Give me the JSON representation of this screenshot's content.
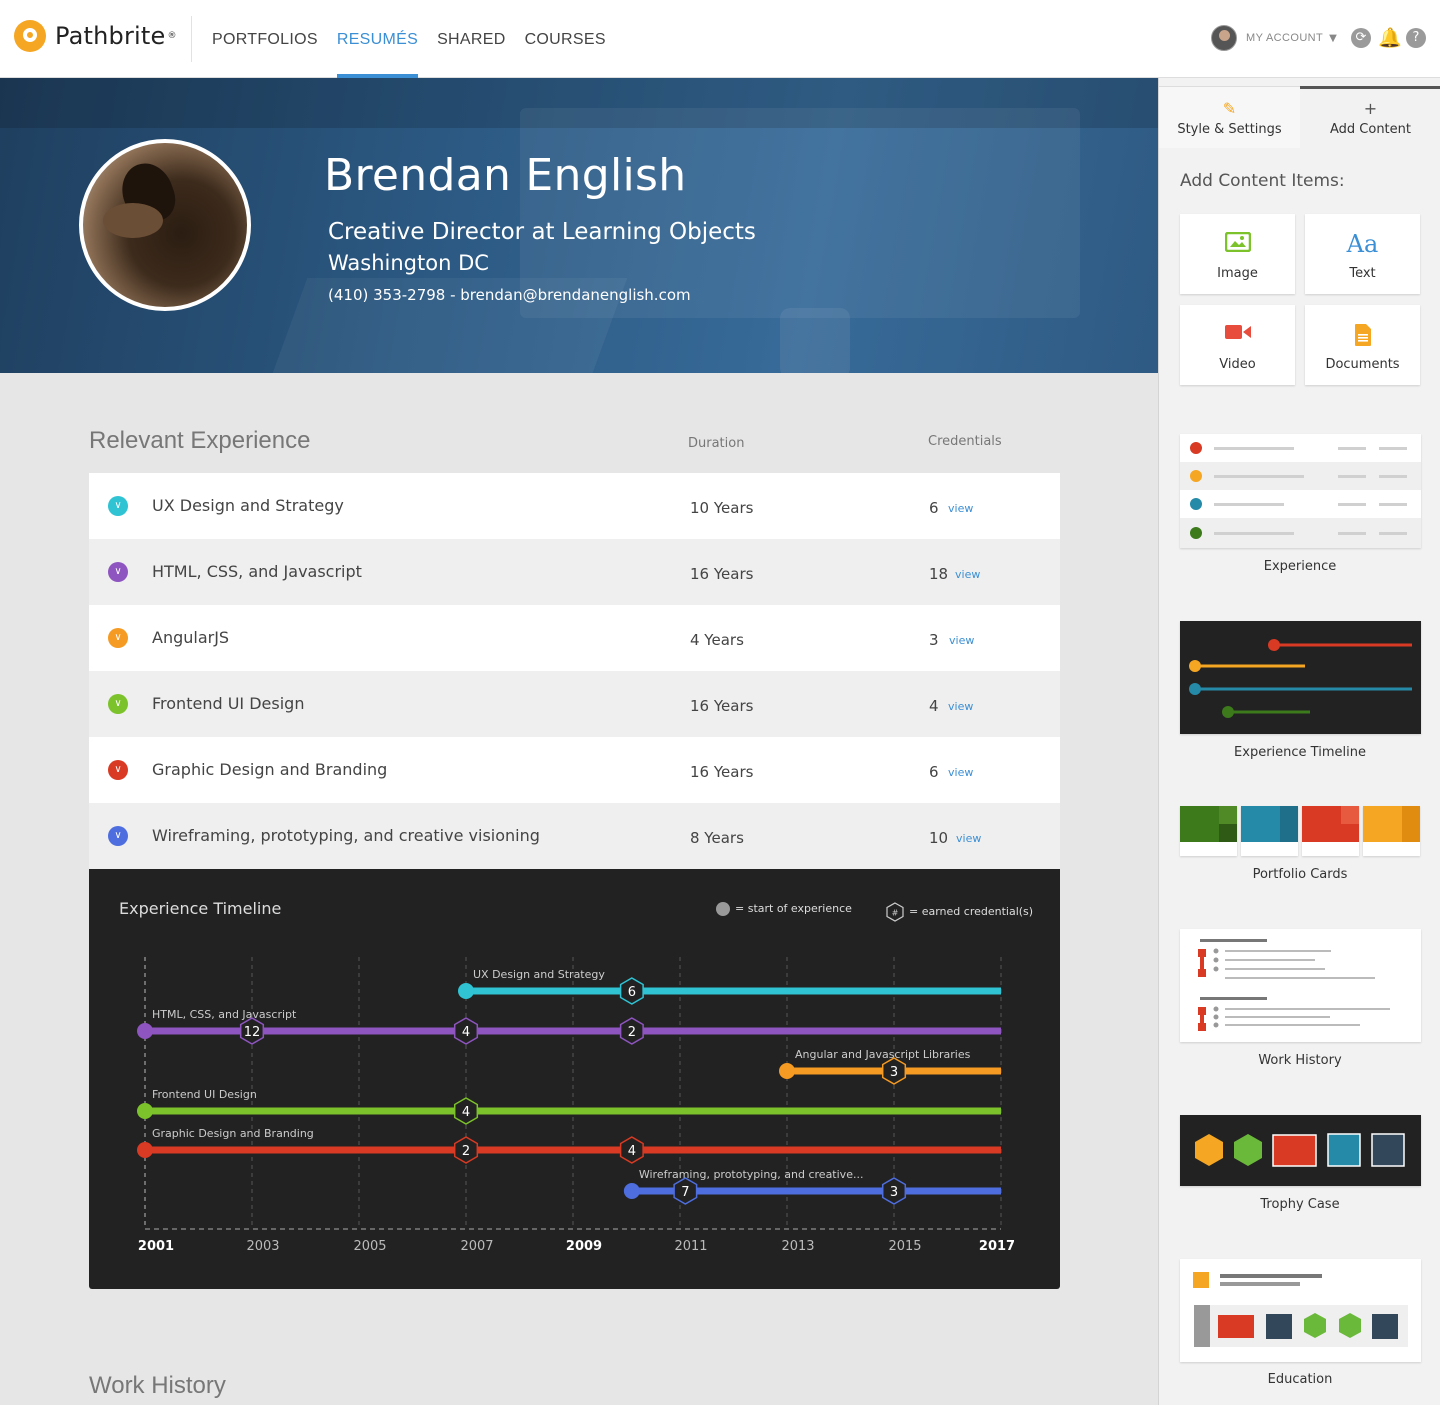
{
  "app": {
    "brand": "Pathbrite",
    "nav": [
      {
        "label": "PORTFOLIOS",
        "active": false
      },
      {
        "label": "RESUMÉS",
        "active": true
      },
      {
        "label": "SHARED",
        "active": false
      },
      {
        "label": "COURSES",
        "active": false
      }
    ],
    "account_label": "MY ACCOUNT",
    "icons": [
      "sync-icon",
      "bell-icon",
      "help-icon"
    ],
    "accent": "#3b8fd4"
  },
  "profile": {
    "name": "Brendan English",
    "title": "Creative Director at Learning Objects",
    "location": "Washington DC",
    "contact": "(410) 353-2798  -  brendan@brendanenglish.com"
  },
  "experience": {
    "section_title": "Relevant Experience",
    "col_duration": "Duration",
    "col_credentials": "Credentials",
    "view_label": "view",
    "rows": [
      {
        "name": "UX Design and Strategy",
        "duration": "10 Years",
        "credentials": "6",
        "color": "#2fc3d3"
      },
      {
        "name": "HTML, CSS, and Javascript",
        "duration": "16 Years",
        "credentials": "18",
        "color": "#8e55c0"
      },
      {
        "name": "AngularJS",
        "duration": "4 Years",
        "credentials": "3",
        "color": "#f59a22"
      },
      {
        "name": "Frontend UI Design",
        "duration": "16 Years",
        "credentials": "4",
        "color": "#7cc22a"
      },
      {
        "name": "Graphic Design and Branding",
        "duration": "16 Years",
        "credentials": "6",
        "color": "#d93a23"
      },
      {
        "name": "Wireframing, prototyping, and creative visioning",
        "duration": "8 Years",
        "credentials": "10",
        "color": "#4e6ee0"
      }
    ]
  },
  "timeline": {
    "title": "Experience Timeline",
    "legend_start": "= start of experience",
    "legend_cred": "= earned credential(s)",
    "legend_hex": "#",
    "years": [
      {
        "label": "2001",
        "year": 2001,
        "bold": true
      },
      {
        "label": "2003",
        "year": 2003,
        "bold": false
      },
      {
        "label": "2005",
        "year": 2005,
        "bold": false
      },
      {
        "label": "2007",
        "year": 2007,
        "bold": false
      },
      {
        "label": "2009",
        "year": 2009,
        "bold": true
      },
      {
        "label": "2011",
        "year": 2011,
        "bold": false
      },
      {
        "label": "2013",
        "year": 2013,
        "bold": false
      },
      {
        "label": "2015",
        "year": 2015,
        "bold": false
      },
      {
        "label": "2017",
        "year": 2017,
        "bold": true
      }
    ],
    "tracks": [
      {
        "label": "UX Design and Strategy",
        "color": "#2fc3d3",
        "start": 2007.0,
        "creds": [
          {
            "year": 2010.1,
            "n": "6"
          }
        ]
      },
      {
        "label": "HTML, CSS, and Javascript",
        "color": "#8e55c0",
        "start": 2001.0,
        "creds": [
          {
            "year": 2003.0,
            "n": "12"
          },
          {
            "year": 2007.0,
            "n": "4"
          },
          {
            "year": 2010.1,
            "n": "2"
          }
        ]
      },
      {
        "label": "Angular and Javascript Libraries",
        "color": "#f59a22",
        "start": 2013.0,
        "creds": [
          {
            "year": 2015.0,
            "n": "3"
          }
        ]
      },
      {
        "label": "Frontend UI Design",
        "color": "#7cc22a",
        "start": 2001.0,
        "creds": [
          {
            "year": 2007.0,
            "n": "4"
          }
        ]
      },
      {
        "label": "Graphic Design and Branding",
        "color": "#d93a23",
        "start": 2001.0,
        "creds": [
          {
            "year": 2007.0,
            "n": "2"
          },
          {
            "year": 2010.1,
            "n": "4"
          }
        ]
      },
      {
        "label": "Wireframing, prototyping, and creative...",
        "color": "#4e6ee0",
        "start": 2010.1,
        "creds": [
          {
            "year": 2011.1,
            "n": "7"
          },
          {
            "year": 2015.0,
            "n": "3"
          }
        ]
      }
    ]
  },
  "panel": {
    "tab_style": "Style & Settings",
    "tab_add": "Add Content",
    "add_items_label": "Add Content Items:",
    "items": [
      {
        "label": "Image",
        "icon": "image-icon",
        "color": "#7cc22a"
      },
      {
        "label": "Text",
        "icon": "text-icon",
        "glyph": "Aa",
        "color": "#3b8fd4"
      },
      {
        "label": "Video",
        "icon": "video-icon",
        "color": "#e74c3c"
      },
      {
        "label": "Documents",
        "icon": "document-icon",
        "color": "#f5a623"
      }
    ],
    "templates": [
      {
        "label": "Experience"
      },
      {
        "label": "Experience Timeline"
      },
      {
        "label": "Portfolio Cards"
      },
      {
        "label": "Work History"
      },
      {
        "label": "Trophy Case"
      },
      {
        "label": "Education"
      }
    ]
  },
  "work_history": {
    "section_title": "Work History"
  }
}
